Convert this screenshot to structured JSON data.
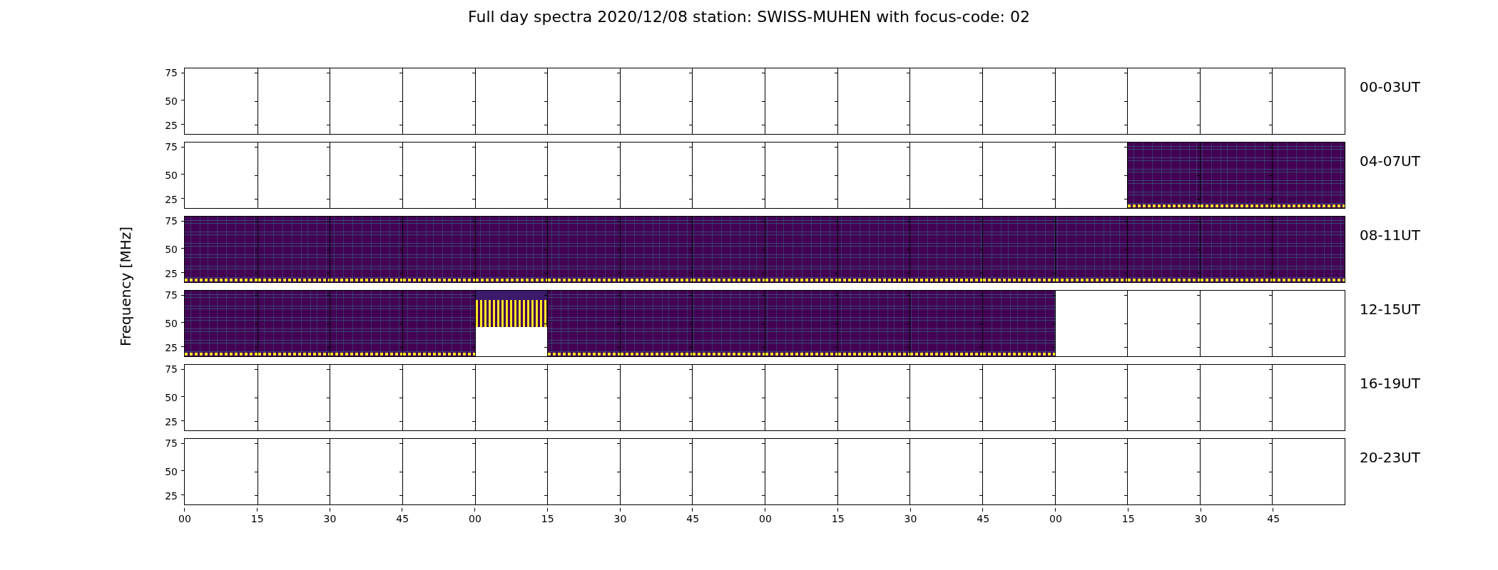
{
  "figure": {
    "title": "Full day spectra 2020/12/08 station: SWISS-MUHEN with focus-code: 02",
    "ylabel": "Frequency [MHz]"
  },
  "rows": [
    {
      "label": "00-03UT",
      "y_ticks": [
        "75",
        "50",
        "25"
      ],
      "cells": [
        {
          "kind": "empty"
        },
        {
          "kind": "empty"
        },
        {
          "kind": "empty"
        },
        {
          "kind": "empty"
        },
        {
          "kind": "empty"
        },
        {
          "kind": "empty"
        },
        {
          "kind": "empty"
        },
        {
          "kind": "empty"
        },
        {
          "kind": "empty"
        },
        {
          "kind": "empty"
        },
        {
          "kind": "empty"
        },
        {
          "kind": "empty"
        },
        {
          "kind": "empty"
        },
        {
          "kind": "empty"
        },
        {
          "kind": "empty"
        },
        {
          "kind": "empty"
        }
      ]
    },
    {
      "label": "04-07UT",
      "y_ticks": [
        "75",
        "50",
        "25"
      ],
      "cells": [
        {
          "kind": "empty"
        },
        {
          "kind": "empty"
        },
        {
          "kind": "empty"
        },
        {
          "kind": "empty"
        },
        {
          "kind": "empty"
        },
        {
          "kind": "empty"
        },
        {
          "kind": "empty"
        },
        {
          "kind": "empty"
        },
        {
          "kind": "empty"
        },
        {
          "kind": "empty"
        },
        {
          "kind": "empty"
        },
        {
          "kind": "empty"
        },
        {
          "kind": "empty"
        },
        {
          "kind": "spectrum"
        },
        {
          "kind": "spectrum"
        },
        {
          "kind": "spectrum"
        }
      ]
    },
    {
      "label": "08-11UT",
      "y_ticks": [
        "75",
        "50",
        "25"
      ],
      "cells": [
        {
          "kind": "spectrum"
        },
        {
          "kind": "spectrum"
        },
        {
          "kind": "spectrum"
        },
        {
          "kind": "spectrum"
        },
        {
          "kind": "spectrum"
        },
        {
          "kind": "spectrum"
        },
        {
          "kind": "spectrum"
        },
        {
          "kind": "spectrum"
        },
        {
          "kind": "spectrum"
        },
        {
          "kind": "spectrum"
        },
        {
          "kind": "spectrum"
        },
        {
          "kind": "spectrum"
        },
        {
          "kind": "spectrum"
        },
        {
          "kind": "spectrum"
        },
        {
          "kind": "spectrum"
        },
        {
          "kind": "spectrum"
        }
      ]
    },
    {
      "label": "12-15UT",
      "y_ticks": [
        "75",
        "50",
        "25"
      ],
      "cells": [
        {
          "kind": "spectrum"
        },
        {
          "kind": "spectrum"
        },
        {
          "kind": "spectrum"
        },
        {
          "kind": "spectrum"
        },
        {
          "kind": "partial"
        },
        {
          "kind": "spectrum"
        },
        {
          "kind": "spectrum"
        },
        {
          "kind": "spectrum"
        },
        {
          "kind": "spectrum"
        },
        {
          "kind": "spectrum"
        },
        {
          "kind": "spectrum"
        },
        {
          "kind": "spectrum"
        },
        {
          "kind": "empty"
        },
        {
          "kind": "empty"
        },
        {
          "kind": "empty"
        },
        {
          "kind": "empty"
        }
      ]
    },
    {
      "label": "16-19UT",
      "y_ticks": [
        "75",
        "50",
        "25"
      ],
      "cells": [
        {
          "kind": "empty"
        },
        {
          "kind": "empty"
        },
        {
          "kind": "empty"
        },
        {
          "kind": "empty"
        },
        {
          "kind": "empty"
        },
        {
          "kind": "empty"
        },
        {
          "kind": "empty"
        },
        {
          "kind": "empty"
        },
        {
          "kind": "empty"
        },
        {
          "kind": "empty"
        },
        {
          "kind": "empty"
        },
        {
          "kind": "empty"
        },
        {
          "kind": "empty"
        },
        {
          "kind": "empty"
        },
        {
          "kind": "empty"
        },
        {
          "kind": "empty"
        }
      ]
    },
    {
      "label": "20-23UT",
      "y_ticks": [
        "75",
        "50",
        "25"
      ],
      "cells": [
        {
          "kind": "empty"
        },
        {
          "kind": "empty"
        },
        {
          "kind": "empty"
        },
        {
          "kind": "empty"
        },
        {
          "kind": "empty"
        },
        {
          "kind": "empty"
        },
        {
          "kind": "empty"
        },
        {
          "kind": "empty"
        },
        {
          "kind": "empty"
        },
        {
          "kind": "empty"
        },
        {
          "kind": "empty"
        },
        {
          "kind": "empty"
        },
        {
          "kind": "empty"
        },
        {
          "kind": "empty"
        },
        {
          "kind": "empty"
        },
        {
          "kind": "empty"
        }
      ]
    }
  ],
  "x_ticks": [
    "00",
    "15",
    "30",
    "45",
    "00",
    "15",
    "30",
    "45",
    "00",
    "15",
    "30",
    "45",
    "00",
    "15",
    "30",
    "45"
  ]
}
